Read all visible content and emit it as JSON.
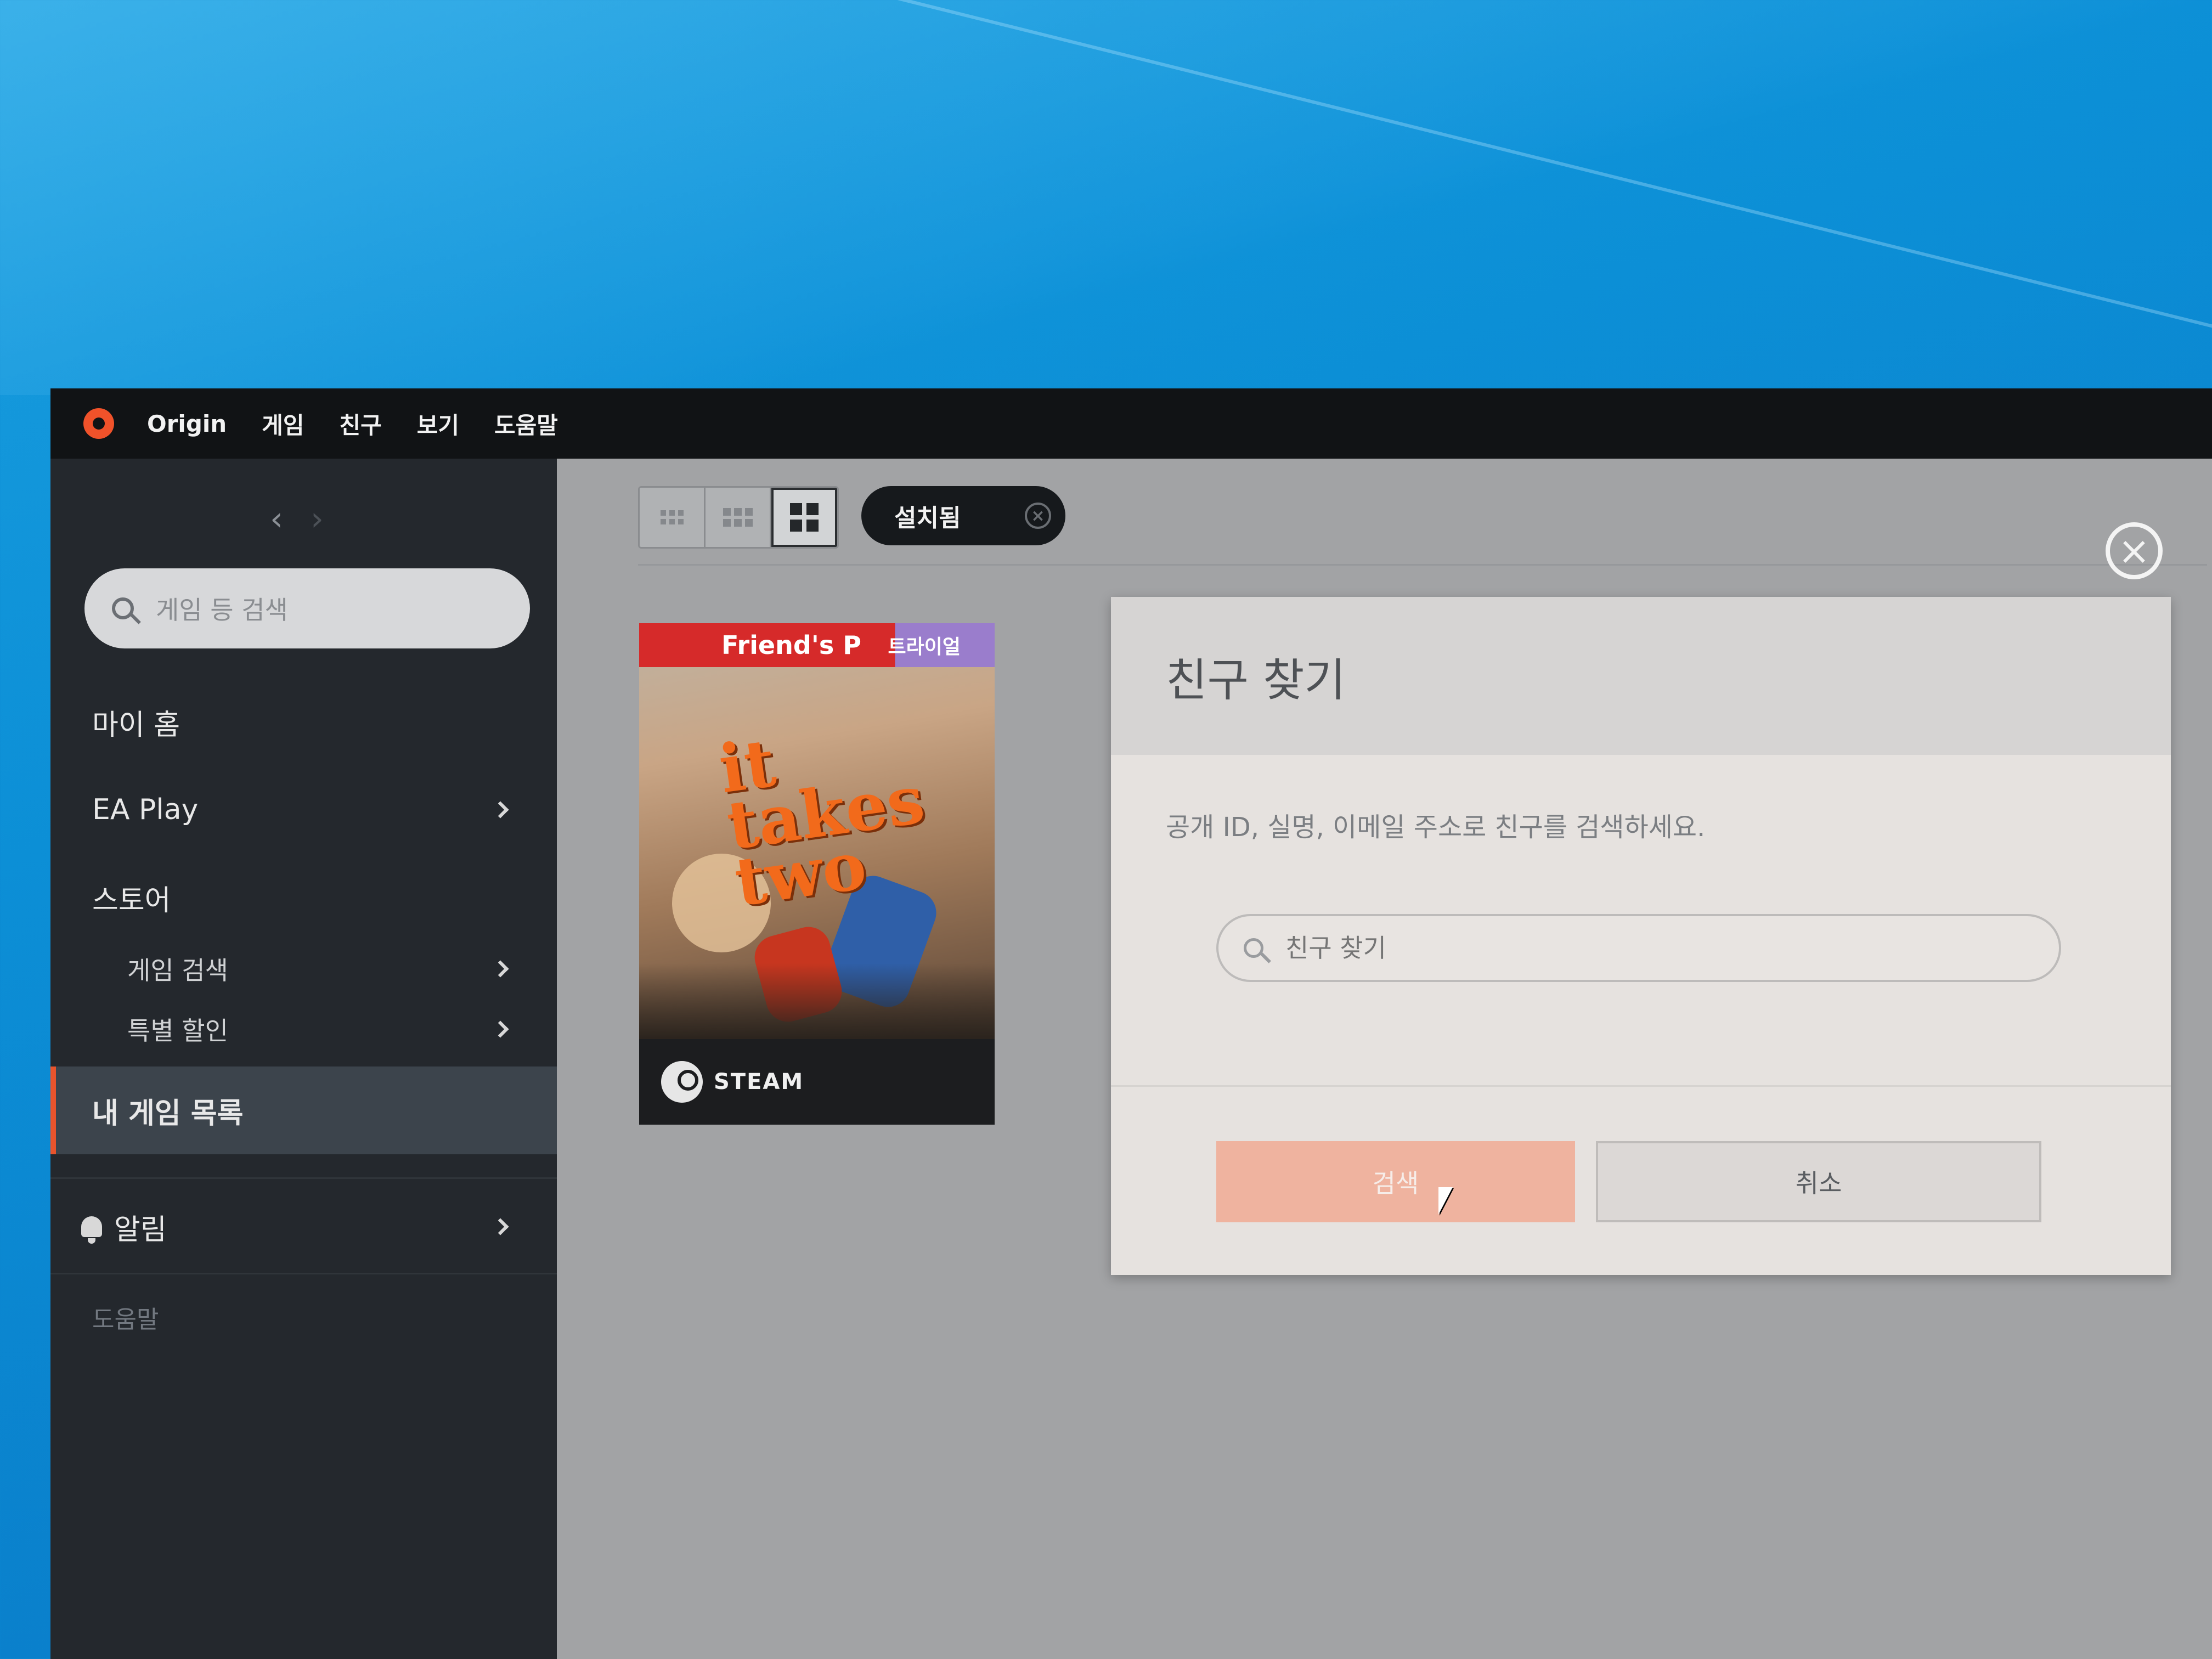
{
  "menubar": {
    "app": "Origin",
    "items": [
      "게임",
      "친구",
      "보기",
      "도움말"
    ]
  },
  "sidebar": {
    "search_placeholder": "게임 등 검색",
    "my_home": "마이 홈",
    "ea_play": "EA Play",
    "store": "스토어",
    "browse_games": "게임 검색",
    "deals": "특별 할인",
    "my_games": "내 게임 목록",
    "notifications": "알림",
    "help": "도움말"
  },
  "toolbar": {
    "filter_label": "설치됨",
    "filter_clear": "×"
  },
  "game_tile": {
    "banner": "Friend's P",
    "trial": "트라이얼",
    "title_line1": "it",
    "title_line2": "takes",
    "title_line3": "two",
    "platform": "STEAM"
  },
  "modal": {
    "title": "친구 찾기",
    "description": "공개 ID, 실명, 이메일 주소로 친구를 검색하세요.",
    "search_placeholder": "친구 찾기",
    "search_button": "검색",
    "cancel_button": "취소",
    "close_symbol": "×"
  },
  "colors": {
    "accent": "#f0522a",
    "sidebar_bg": "#24282d",
    "search_button": "#efb39f"
  }
}
